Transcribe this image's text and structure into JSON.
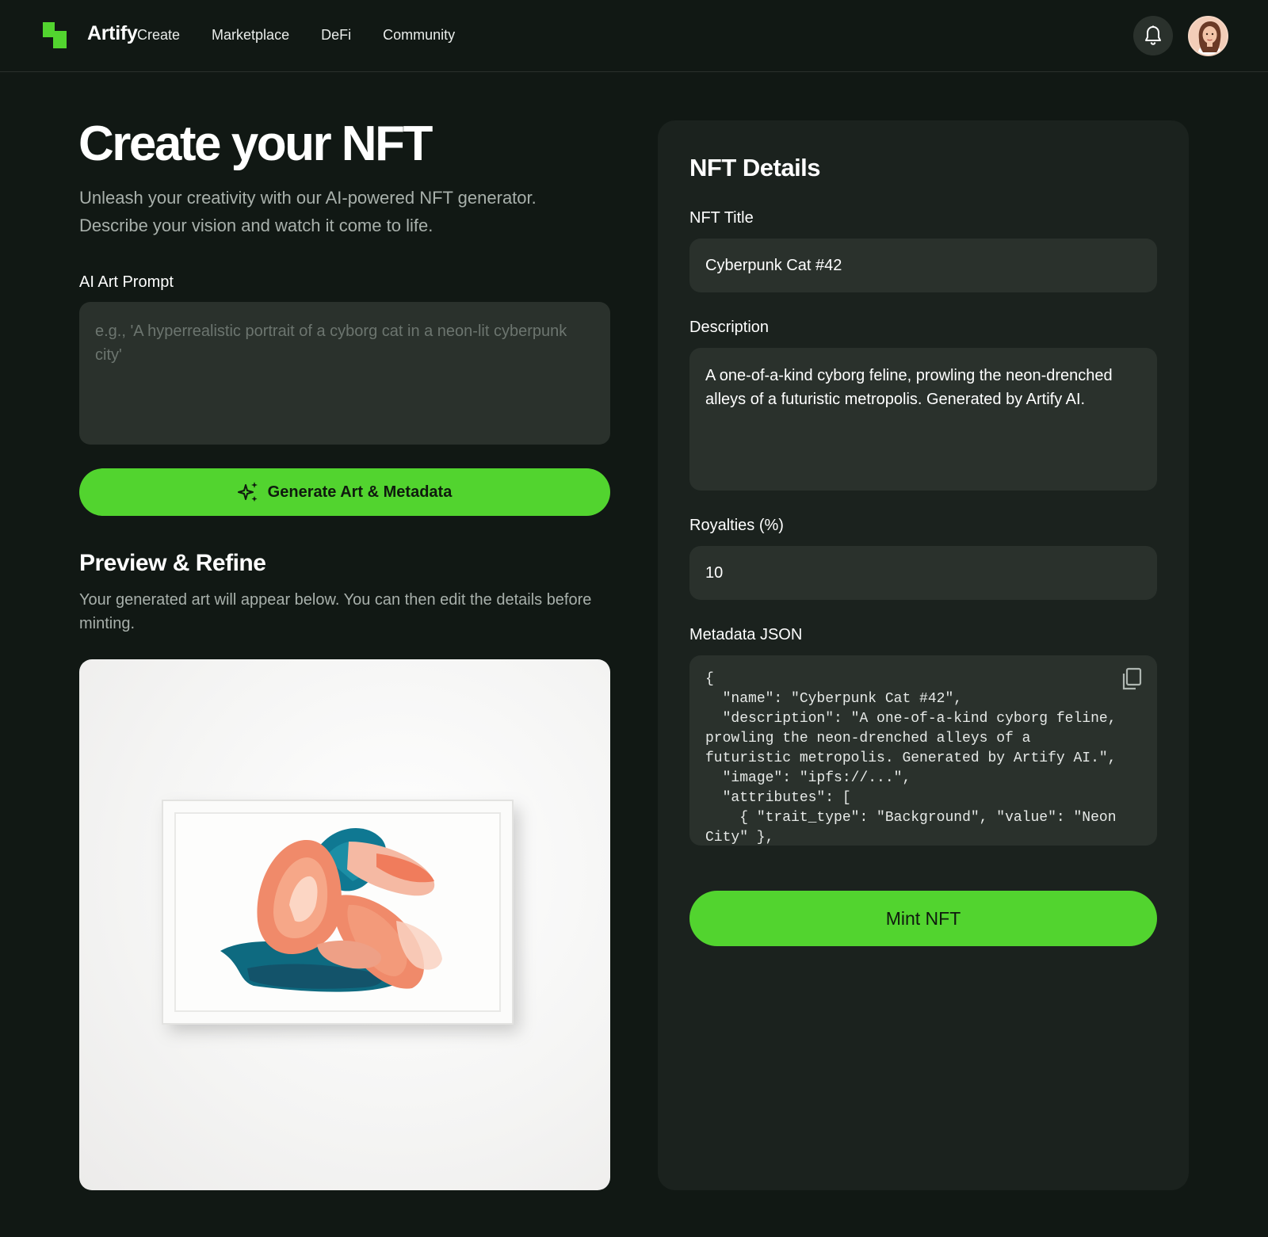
{
  "header": {
    "brand": "Artify",
    "nav": [
      "Create",
      "Marketplace",
      "DeFi",
      "Community"
    ],
    "icons": {
      "logo": "logo-mark-icon",
      "notifications": "bell-icon",
      "avatar": "user-avatar"
    }
  },
  "hero": {
    "title": "Create your NFT",
    "subtitle": "Unleash your creativity with our AI-powered NFT generator. Describe your vision and watch it come to life."
  },
  "prompt": {
    "label": "AI Art Prompt",
    "placeholder": "e.g., 'A hyperrealistic portrait of a cyborg cat in a neon-lit cyberpunk city'",
    "value": ""
  },
  "generate_button": {
    "label": "Generate Art & Metadata",
    "icon": "sparkles-icon"
  },
  "preview": {
    "title": "Preview & Refine",
    "description": "Your generated art will appear below. You can then edit the details before minting."
  },
  "details": {
    "title": "NFT Details",
    "nft_title_label": "NFT Title",
    "nft_title_value": "Cyberpunk Cat #42",
    "description_label": "Description",
    "description_value": "A one-of-a-kind cyborg feline, prowling the neon-drenched alleys of a futuristic metropolis. Generated by Artify AI.",
    "royalties_label": "Royalties (%)",
    "royalties_value": "10",
    "metadata_label": "Metadata JSON",
    "metadata_value": "{\n  \"name\": \"Cyberpunk Cat #42\",\n  \"description\": \"A one-of-a-kind cyborg feline, prowling the neon-drenched alleys of a futuristic metropolis. Generated by Artify AI.\",\n  \"image\": \"ipfs://...\",\n  \"attributes\": [\n    { \"trait_type\": \"Background\", \"value\": \"Neon City\" },"
  },
  "mint_button": {
    "label": "Mint NFT"
  },
  "colors": {
    "accent": "#52d42f",
    "background": "#111814",
    "panel": "#1b221e",
    "field": "#2a312c"
  }
}
